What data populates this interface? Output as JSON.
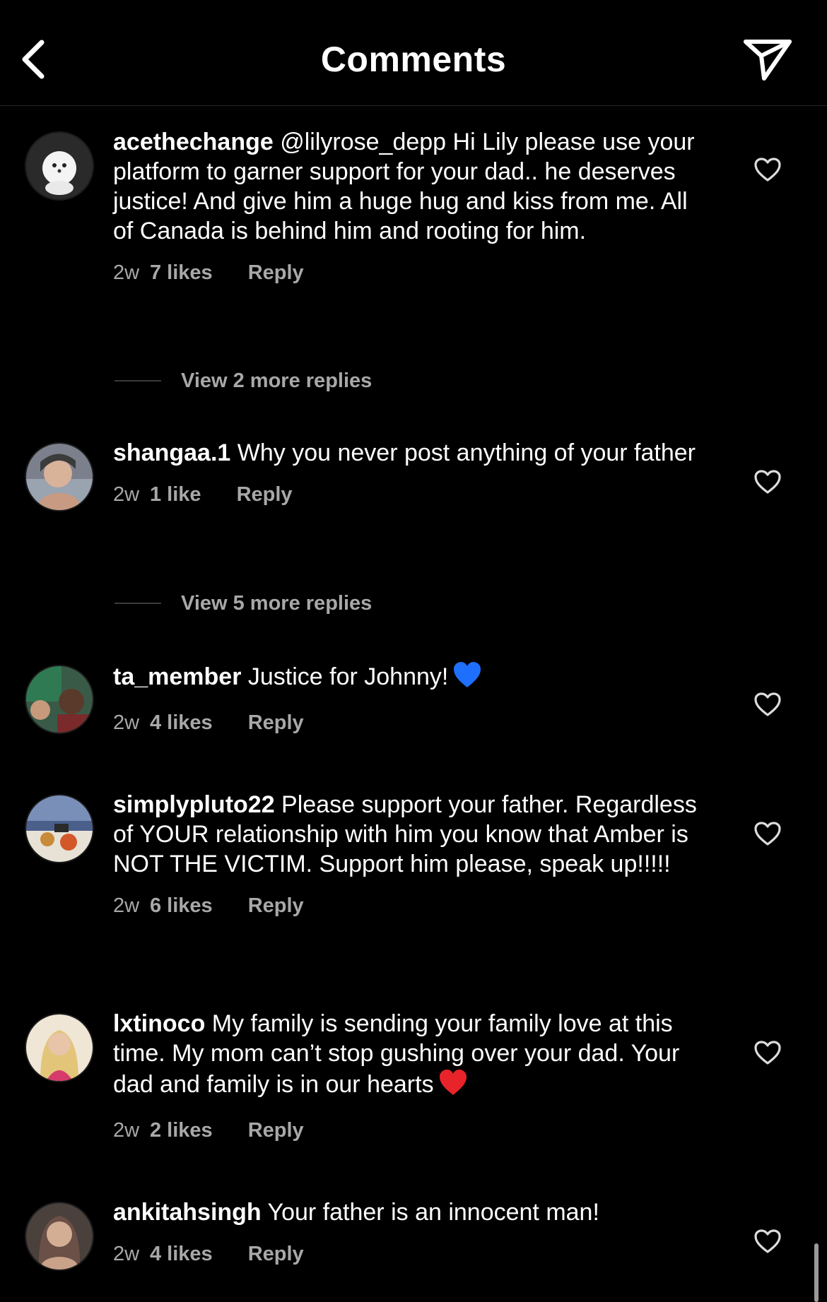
{
  "header": {
    "title": "Comments",
    "back_icon": "chevron-left-icon",
    "send_icon": "paper-plane-icon"
  },
  "comments": [
    {
      "username": "acethechange",
      "text": " @lilyrose_depp Hi Lily please use your platform to garner support for your dad.. he deserves justice! And give him a huge hug and kiss from me. All of Canada is behind him and rooting for him.",
      "time": "2w",
      "likes": "7 likes",
      "reply": "Reply",
      "avatar_colors": [
        "#3a3a3a",
        "#f2f2f2"
      ],
      "view_replies": "View 2 more replies"
    },
    {
      "username": "shangaa.1",
      "text": " Why you never post anything of your father",
      "time": "2w",
      "likes": "1 like",
      "reply": "Reply",
      "avatar_colors": [
        "#7a7f8a",
        "#d9b29a"
      ],
      "view_replies": "View 5 more replies"
    },
    {
      "username": "ta_member",
      "text": " Justice for Johnny!",
      "emoji": "blue-heart",
      "time": "2w",
      "likes": "4 likes",
      "reply": "Reply",
      "avatar_colors": [
        "#2e6b4a",
        "#5a3a2a"
      ]
    },
    {
      "username": "simplypluto22",
      "text": " Please support your father. Regardless of YOUR relationship with him you know that Amber is NOT THE VICTIM. Support him please, speak up!!!!!",
      "time": "2w",
      "likes": "6 likes",
      "reply": "Reply",
      "avatar_colors": [
        "#4a5f8a",
        "#c98a3a"
      ]
    },
    {
      "username": "lxtinoco",
      "text": " My family is sending your family love at this time. My mom can’t stop gushing over your dad. Your dad and family is in our hearts",
      "emoji": "red-heart",
      "time": "2w",
      "likes": "2 likes",
      "reply": "Reply",
      "avatar_colors": [
        "#e8d7b0",
        "#d63a6a"
      ]
    },
    {
      "username": "ankitahsingh",
      "text": " Your father is an innocent man!",
      "time": "2w",
      "likes": "4 likes",
      "reply": "Reply",
      "avatar_colors": [
        "#5a4a44",
        "#c9a28a"
      ]
    }
  ],
  "colors": {
    "background": "#000000",
    "text": "#ffffff",
    "muted": "#a8a8a8",
    "blue_heart": "#1f6fff",
    "red_heart": "#e8232a"
  }
}
